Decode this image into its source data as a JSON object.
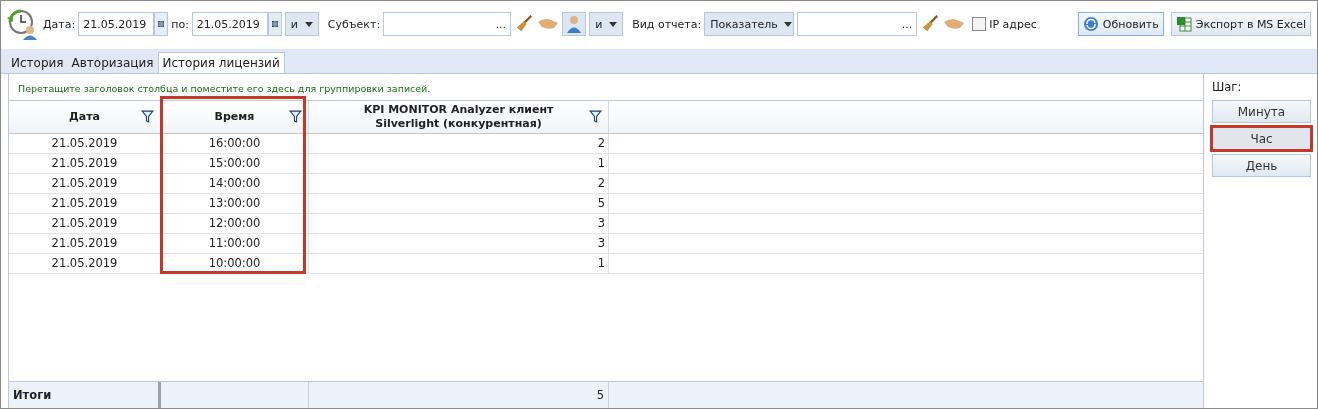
{
  "toolbar": {
    "date_from_label": "Дата:",
    "date_from": "21.05.2019",
    "date_to_label": "по:",
    "date_to": "21.05.2019",
    "logic_1": "и",
    "subject_label": "Субъект:",
    "subject_dots": "...",
    "logic_2": "и",
    "report_label": "Вид отчета:",
    "report_type": "Показатель",
    "report_dots": "...",
    "ip_label": "IP адрес",
    "ip_checked": false,
    "refresh": "Обновить",
    "export": "Экспорт в MS Excel"
  },
  "tabs": [
    {
      "label": "История",
      "selected": false
    },
    {
      "label": "Авторизация",
      "selected": false
    },
    {
      "label": "История лицензий",
      "selected": true
    }
  ],
  "group_hint": "Перетащите заголовок столбца и поместите его здесь для группировки записей.",
  "table": {
    "columns": [
      {
        "label": "Дата",
        "highlighted": false
      },
      {
        "label": "Время",
        "highlighted": true
      },
      {
        "label": "KPI MONITOR Analyzer клиент Silverlight (конкурентная)",
        "highlighted": false
      }
    ],
    "rows": [
      [
        "21.05.2019",
        "16:00:00",
        "2"
      ],
      [
        "21.05.2019",
        "15:00:00",
        "1"
      ],
      [
        "21.05.2019",
        "14:00:00",
        "2"
      ],
      [
        "21.05.2019",
        "13:00:00",
        "5"
      ],
      [
        "21.05.2019",
        "12:00:00",
        "3"
      ],
      [
        "21.05.2019",
        "11:00:00",
        "3"
      ],
      [
        "21.05.2019",
        "10:00:00",
        "1"
      ]
    ],
    "totals": {
      "label": "Итоги",
      "value": "5"
    }
  },
  "step": {
    "label": "Шаг:",
    "buttons": [
      {
        "label": "Минута",
        "selected": false
      },
      {
        "label": "Час",
        "selected": true
      },
      {
        "label": "День",
        "selected": false
      }
    ]
  }
}
